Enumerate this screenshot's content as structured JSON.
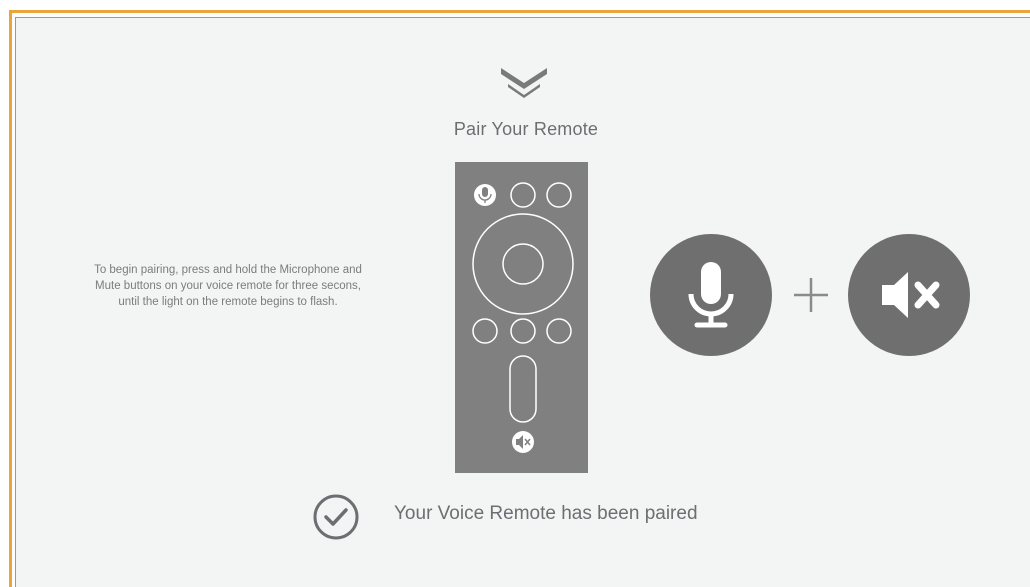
{
  "screen": {
    "title": "Pair Your Remote",
    "instructions": "To begin pairing, press and hold the Microphone and Mute buttons on your voice remote for three secons, until the light on the remote begins to flash.",
    "status_text": "Your Voice Remote has been paired"
  },
  "icons": {
    "logo": "brand-v-logo-icon",
    "microphone": "microphone-icon",
    "mute": "mute-icon",
    "plus": "plus-icon",
    "check": "check-circle-icon"
  },
  "colors": {
    "frame_border": "#e8a53a",
    "background": "#f3f4f4",
    "remote_body": "#808080",
    "button_fill": "#707070",
    "text": "#6d6e71"
  }
}
